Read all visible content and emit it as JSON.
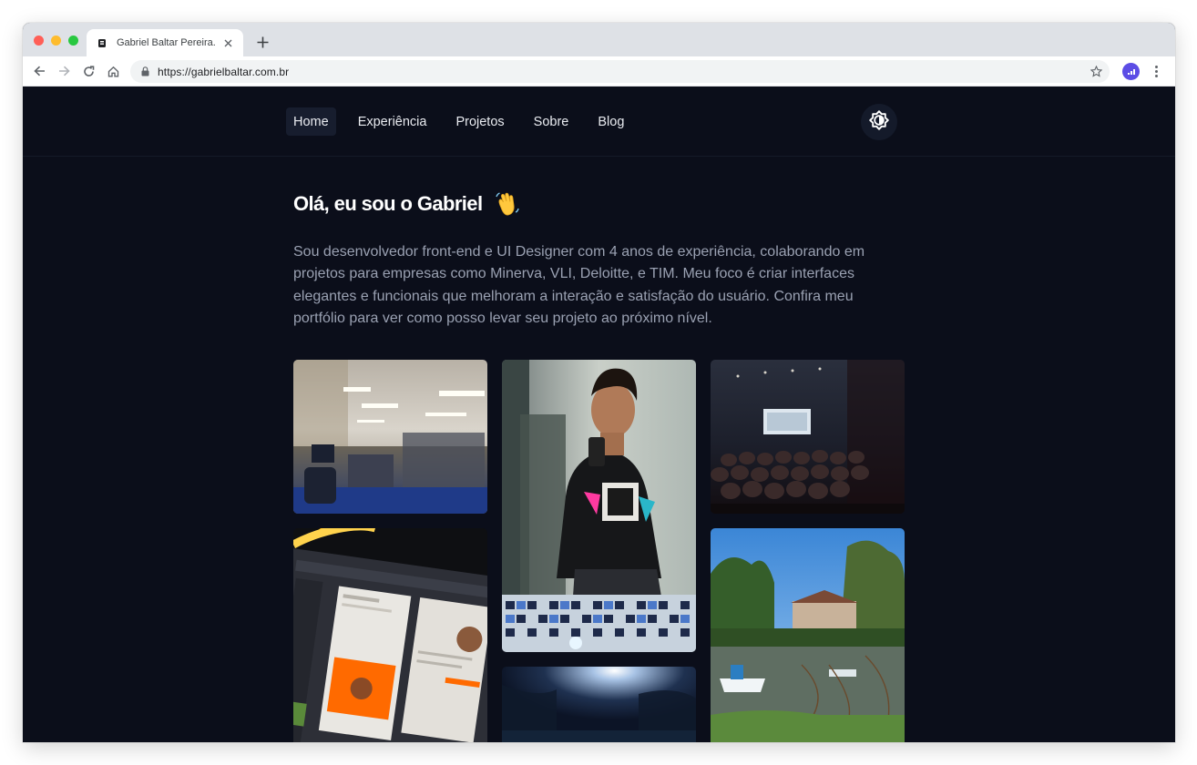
{
  "browser": {
    "tab_title": "Gabriel Baltar Pereira...",
    "url": "https://gabrielbaltar.com.br",
    "traffic_lights": [
      "#ff5f57",
      "#febc2e",
      "#28c840"
    ]
  },
  "nav": {
    "items": [
      {
        "label": "Home",
        "active": true
      },
      {
        "label": "Experiência",
        "active": false
      },
      {
        "label": "Projetos",
        "active": false
      },
      {
        "label": "Sobre",
        "active": false
      },
      {
        "label": "Blog",
        "active": false
      }
    ],
    "theme_toggle_icon": "brightness-icon"
  },
  "hero": {
    "title": "Olá, eu sou o Gabriel",
    "emoji_icon": "waving-hand-icon",
    "description": "Sou desenvolvedor front-end e UI Designer com 4 anos de experiência, colaborando em projetos para empresas como Minerva, VLI, Deloitte, e TIM. Meu foco é criar interfaces elegantes e funcionais que melhoram a interação e satisfação do usuário. Confira meu portfólio para ver como posso levar seu projeto ao próximo nível."
  },
  "gallery": {
    "photos": [
      {
        "name": "office-photo"
      },
      {
        "name": "selfie-photo"
      },
      {
        "name": "conference-photo"
      },
      {
        "name": "design-screen-photo"
      },
      {
        "name": "lake-photo"
      },
      {
        "name": "forest-photo"
      }
    ]
  },
  "colors": {
    "background": "#0b0e1a",
    "nav_active": "#171d2e",
    "text_muted": "#9aa1b2",
    "accent_extension": "#5c4de5"
  }
}
